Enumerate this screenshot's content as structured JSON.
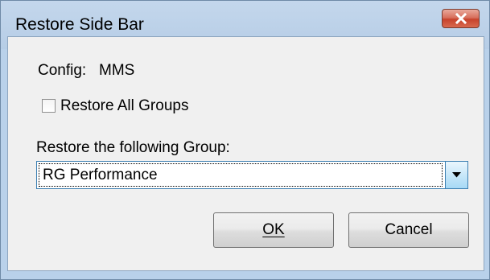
{
  "window": {
    "title": "Restore Side Bar",
    "close_icon": "close-icon"
  },
  "config": {
    "label": "Config:",
    "value": "MMS"
  },
  "restore_all": {
    "label": "Restore All Groups",
    "checked": false
  },
  "group": {
    "label": "Restore the following Group:",
    "selected": "RG Performance",
    "dropdown_icon": "chevron-down-icon"
  },
  "buttons": {
    "ok_label": "OK",
    "cancel_label": "Cancel"
  },
  "colors": {
    "title_bar": "#b9d1ea",
    "close_button": "#c7432c",
    "dialog_body": "#f0f0f0",
    "focus_border": "#3c7fb1"
  }
}
